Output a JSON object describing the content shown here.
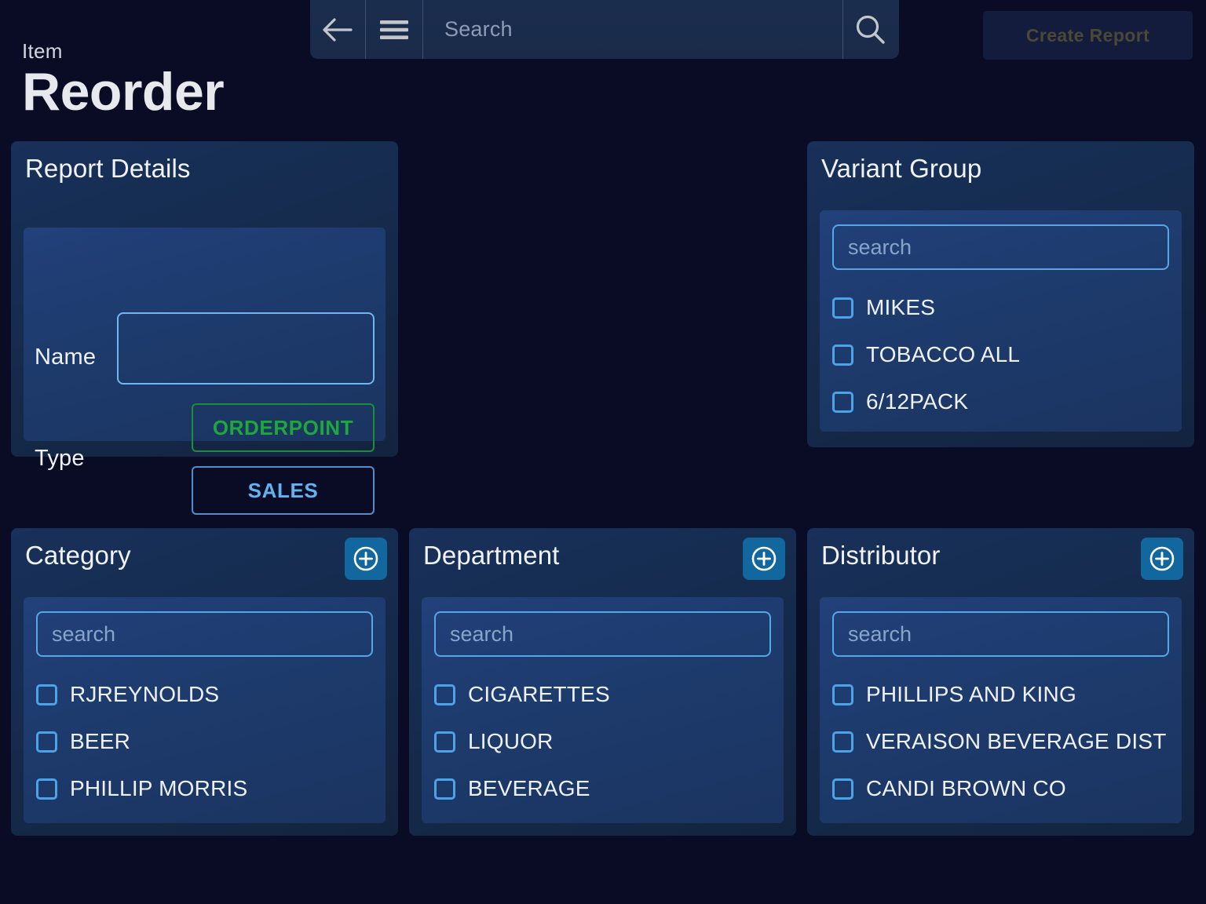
{
  "theme": {
    "page_bg": "#0a0c26",
    "card_bg": "#152a4a",
    "panel_bg": "#1d3a6b",
    "accent_blue": "#4da3e8",
    "add_button_bg": "#12679e",
    "green": "#1ea83c",
    "disabled_text": "#4b4836"
  },
  "topbar": {
    "back_icon": "arrow-left-icon",
    "menu_icon": "hamburger-menu-icon",
    "search_placeholder": "Search",
    "search_value": "",
    "search_submit_icon": "magnifier-icon"
  },
  "header": {
    "create_report_label": "Create Report",
    "create_report_disabled": true,
    "eyebrow": "Item",
    "title": "Reorder"
  },
  "report_details": {
    "title": "Report Details",
    "name_label": "Name",
    "name_value": "",
    "name_placeholder": "",
    "type_label": "Type",
    "type_options": [
      {
        "label": "ORDERPOINT",
        "style": "green"
      },
      {
        "label": "SALES",
        "style": "blue"
      }
    ]
  },
  "variant_group": {
    "title": "Variant Group",
    "search_placeholder": "search",
    "search_value": "",
    "options": [
      {
        "label": "MIKES",
        "checked": false
      },
      {
        "label": "TOBACCO ALL",
        "checked": false
      },
      {
        "label": "6/12PACK",
        "checked": false
      }
    ]
  },
  "category": {
    "title": "Category",
    "add_icon": "circle-plus-icon",
    "search_placeholder": "search",
    "search_value": "",
    "options": [
      {
        "label": "RJREYNOLDS",
        "checked": false
      },
      {
        "label": "BEER",
        "checked": false
      },
      {
        "label": "PHILLIP MORRIS",
        "checked": false
      }
    ]
  },
  "department": {
    "title": "Department",
    "add_icon": "circle-plus-icon",
    "search_placeholder": "search",
    "search_value": "",
    "options": [
      {
        "label": "CIGARETTES",
        "checked": false
      },
      {
        "label": "LIQUOR",
        "checked": false
      },
      {
        "label": "BEVERAGE",
        "checked": false
      }
    ]
  },
  "distributor": {
    "title": "Distributor",
    "add_icon": "circle-plus-icon",
    "search_placeholder": "search",
    "search_value": "",
    "options": [
      {
        "label": "PHILLIPS AND KING",
        "checked": false
      },
      {
        "label": "VERAISON BEVERAGE DIST",
        "checked": false
      },
      {
        "label": "CANDI BROWN CO",
        "checked": false
      }
    ]
  }
}
